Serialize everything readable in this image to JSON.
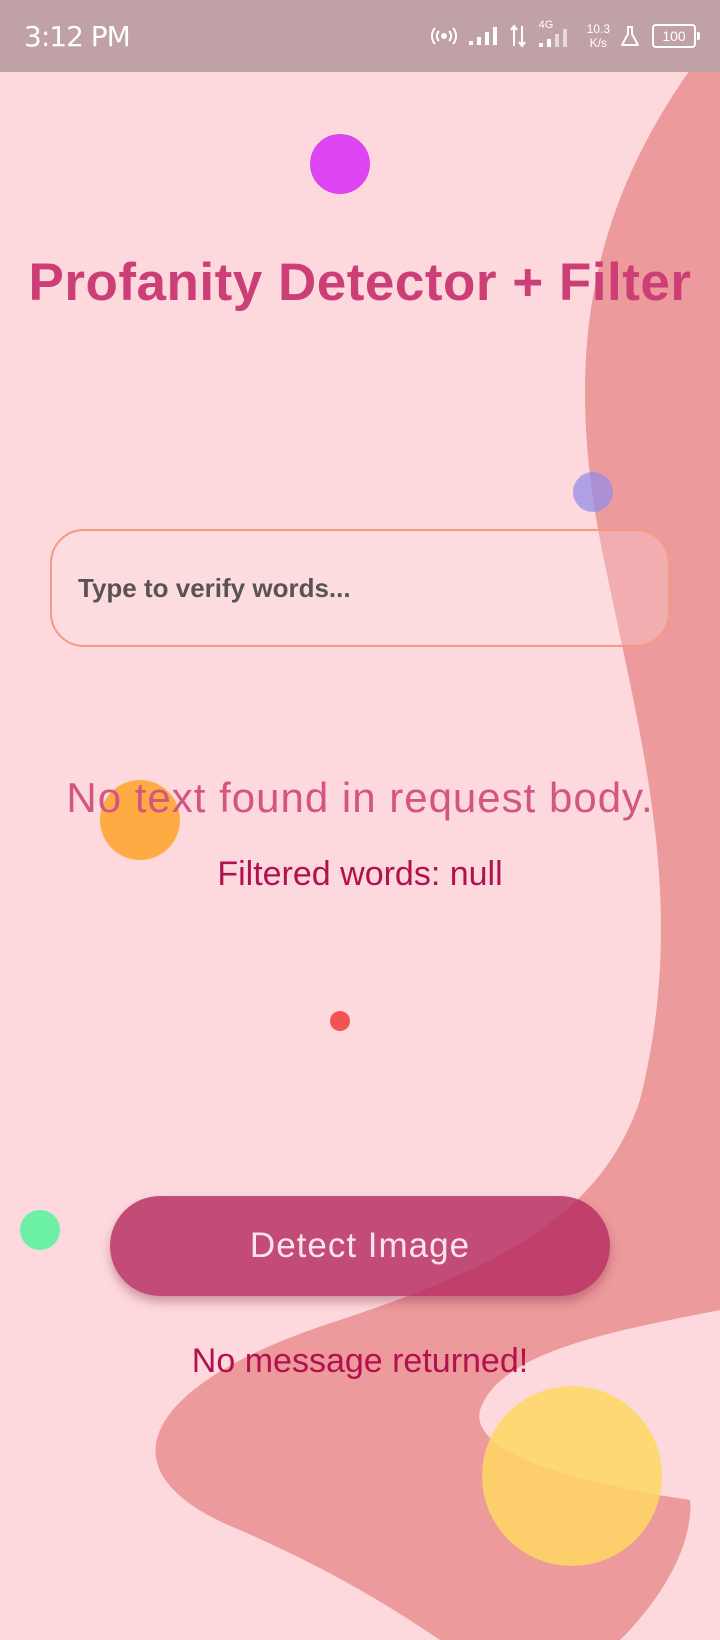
{
  "status_bar": {
    "time": "3:12 PM",
    "net_type": "4G",
    "net_speed_value": "10.3",
    "net_speed_unit": "K/s",
    "battery": "100",
    "icons": [
      "hotspot-icon",
      "signal-icon",
      "data-arrows-icon",
      "signal-4g-icon",
      "flask-icon",
      "battery-icon"
    ]
  },
  "app": {
    "title": "Profanity Detector + Filter",
    "input_placeholder": "Type to verify words...",
    "result_text": "No text found in request body.",
    "filtered_text": "Filtered words: null",
    "detect_button_label": "Detect Image",
    "message_text": "No message returned!"
  },
  "colors": {
    "background": "#fdd9dd",
    "wave": "#ec9a9b",
    "status_bar": "#c0a1a5",
    "accent": "#cc3e76",
    "button": "#b62c60",
    "input_border": "#f59a82",
    "text_dark_pink": "#b3104f"
  }
}
